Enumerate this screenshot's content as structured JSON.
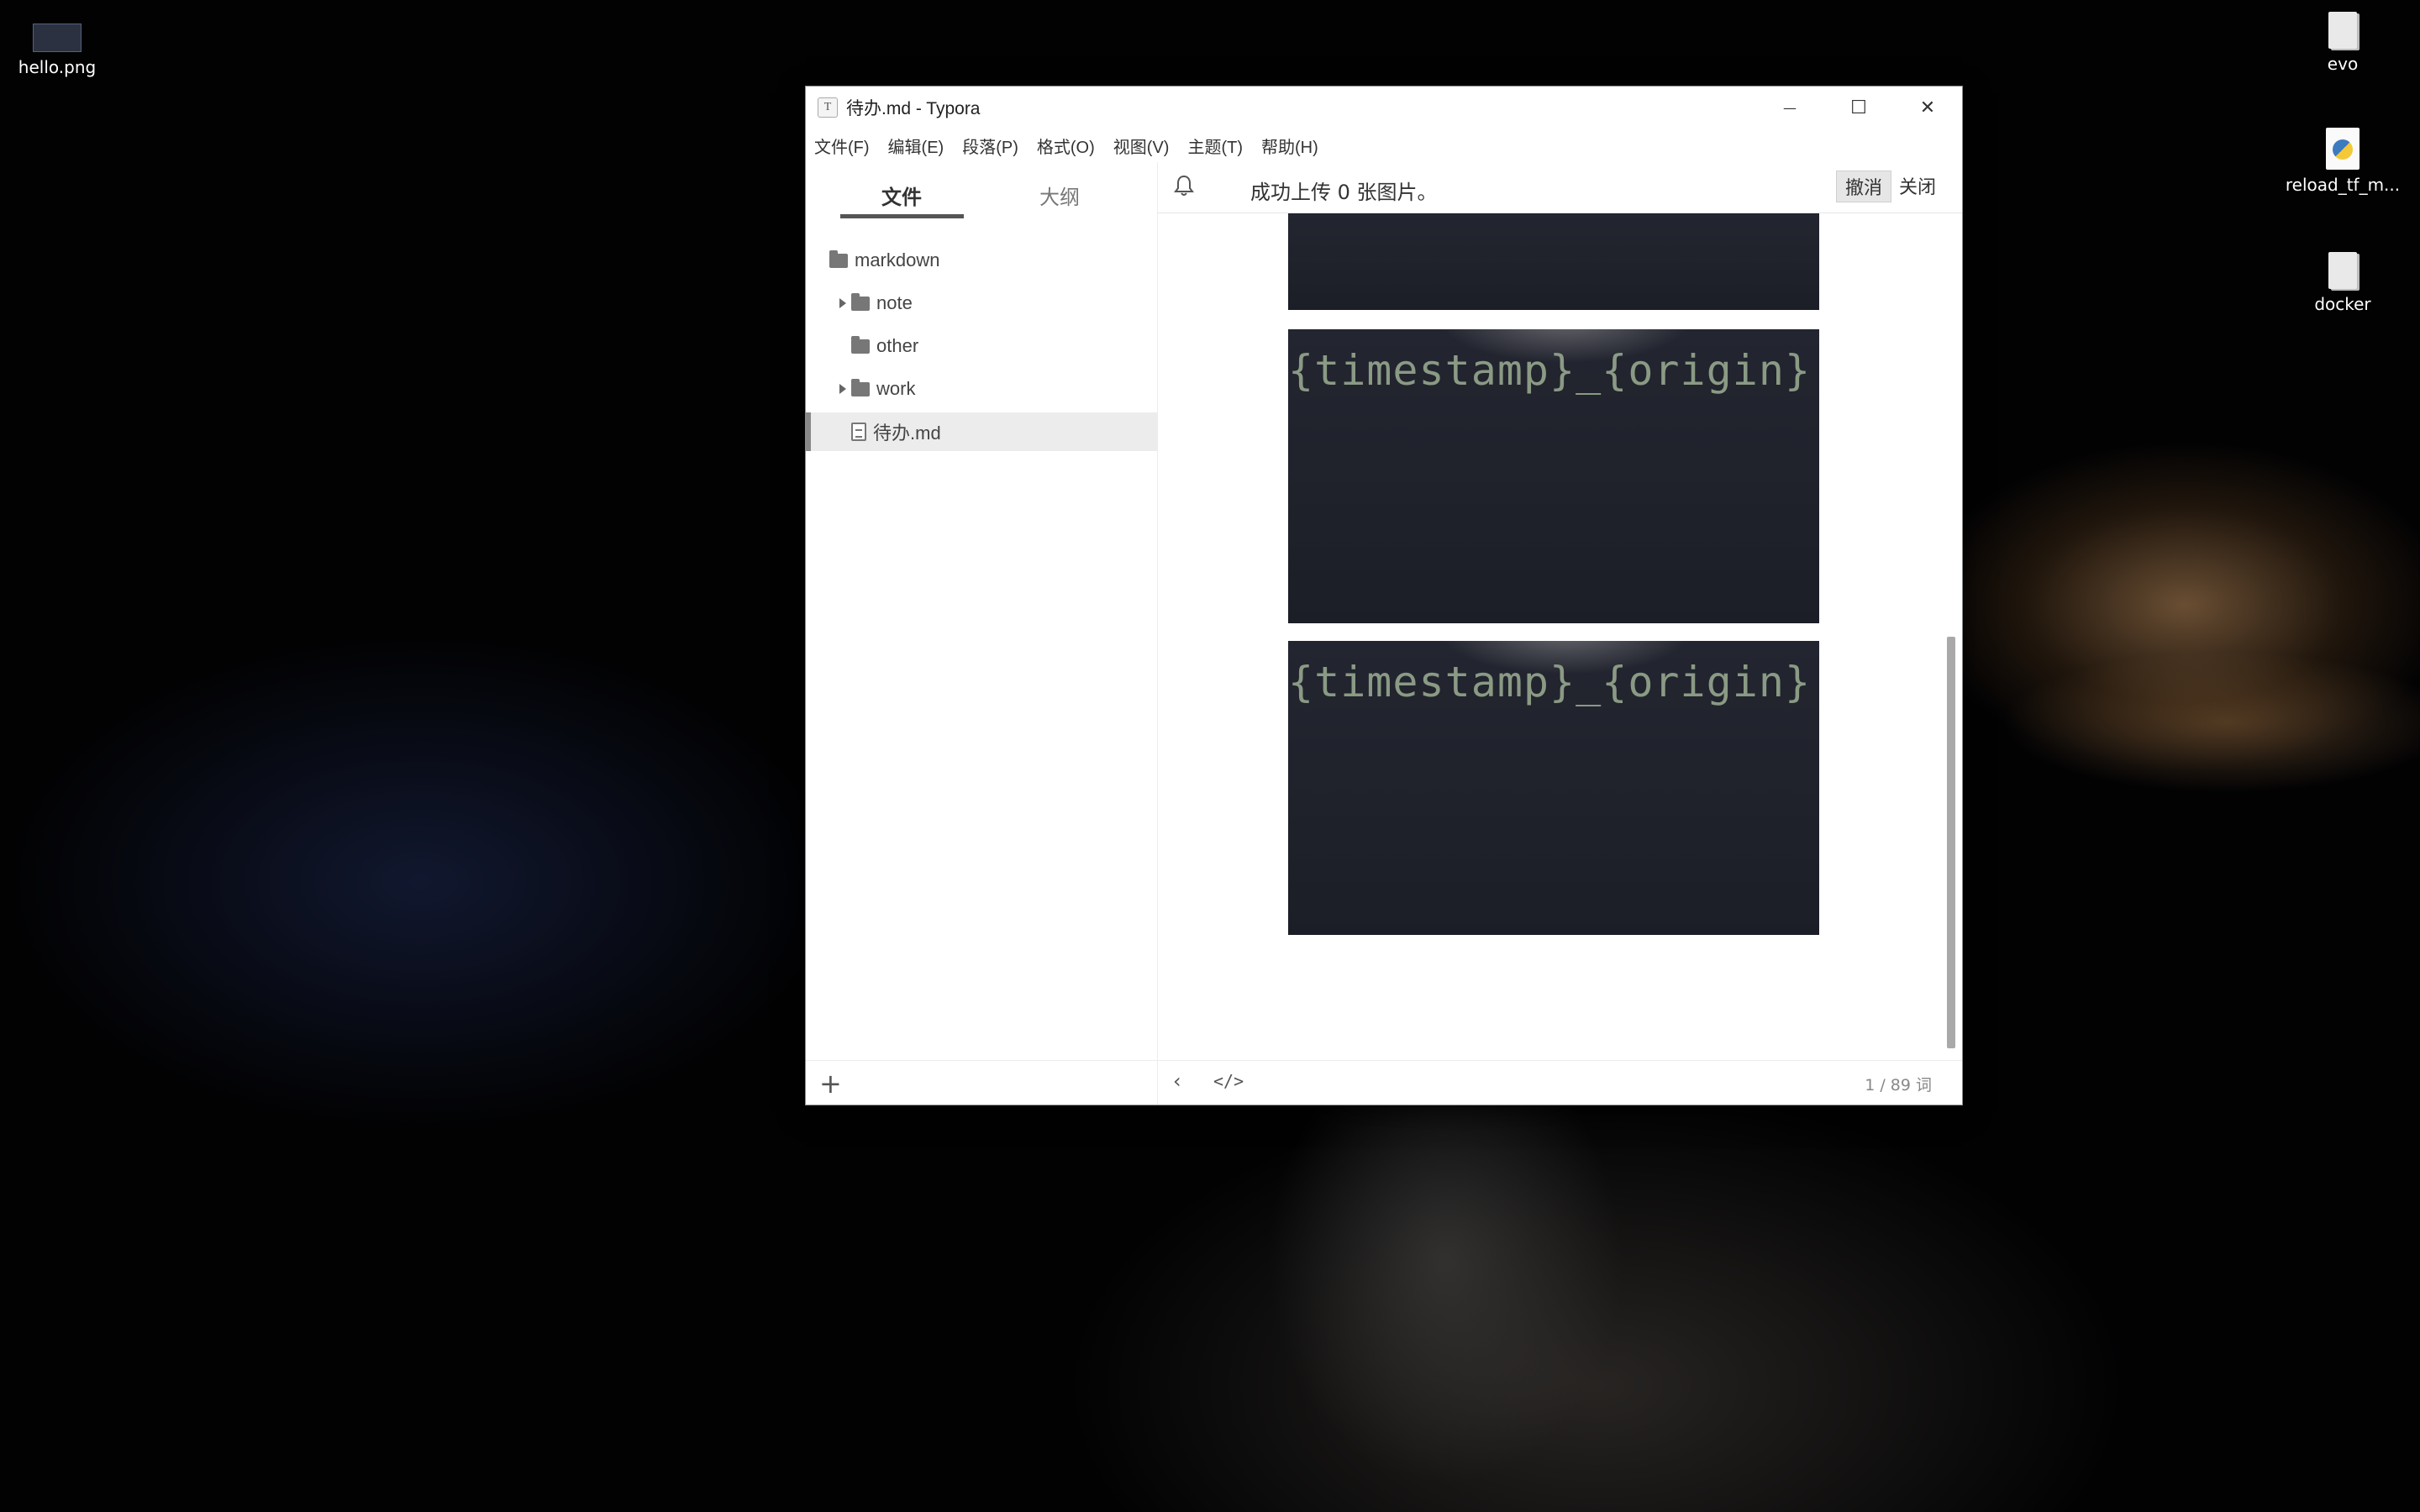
{
  "desktop": {
    "icons": [
      {
        "label": "hello.png",
        "icon": "image-file-icon"
      },
      {
        "label": "evo",
        "icon": "file-icon"
      },
      {
        "label": "reload_tf_m...",
        "icon": "python-file-icon"
      },
      {
        "label": "docker",
        "icon": "file-icon"
      }
    ]
  },
  "window": {
    "app_icon": "T",
    "title": "待办.md - Typora",
    "controls": {
      "minimize": "—",
      "maximize": "☐",
      "close": "✕"
    }
  },
  "menu": [
    "文件(F)",
    "编辑(E)",
    "段落(P)",
    "格式(O)",
    "视图(V)",
    "主题(T)",
    "帮助(H)"
  ],
  "sidebar": {
    "tabs": [
      "文件",
      "大纲"
    ],
    "active_tab": "文件",
    "tree": [
      {
        "label": "markdown",
        "type": "folder",
        "expanded": true
      },
      {
        "label": "note",
        "type": "folder",
        "collapsed": true
      },
      {
        "label": "other",
        "type": "folder"
      },
      {
        "label": "work",
        "type": "folder",
        "collapsed": true
      },
      {
        "label": "待办.md",
        "type": "file",
        "selected": true
      }
    ],
    "add_label": "+"
  },
  "notification": {
    "message": "成功上传 0 张图片。",
    "undo": "撤消",
    "close": "关闭"
  },
  "editor": {
    "images": [
      {
        "text": ""
      },
      {
        "text": "{timestamp}_{origin}"
      },
      {
        "text": "{timestamp}_{origin}"
      }
    ]
  },
  "status": {
    "back": "‹",
    "source_toggle": "</>",
    "word_count": "1 / 89 词"
  },
  "colors": {
    "accent": "#555555",
    "image_bg": "#1e2029",
    "image_text": "#8a9a84"
  }
}
